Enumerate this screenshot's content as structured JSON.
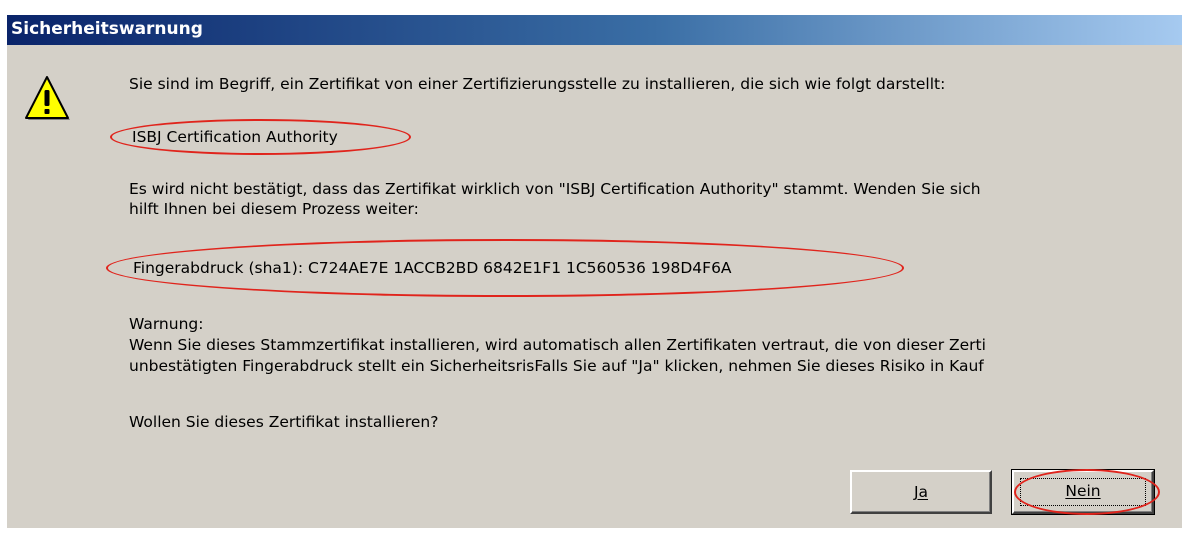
{
  "window": {
    "title": "Sicherheitswarnung"
  },
  "message": {
    "intro": "Sie sind im Begriff, ein Zertifikat von einer Zertifizierungsstelle zu installieren, die sich wie folgt darstellt:",
    "issuer": "ISBJ Certification Authority",
    "not_verified_line1": "Es wird nicht bestätigt, dass das Zertifikat wirklich von \"ISBJ Certification Authority\" stammt. Wenden Sie sich",
    "not_verified_line2": "hilft Ihnen bei diesem Prozess weiter:",
    "fingerprint": "Fingerabdruck (sha1): C724AE7E 1ACCB2BD 6842E1F1 1C560536 198D4F6A",
    "warning_heading": "Warnung:",
    "warning_line1": "Wenn Sie dieses Stammzertifikat installieren, wird automatisch allen Zertifikaten vertraut, die von dieser Zerti",
    "warning_line2": "unbestätigten Fingerabdruck stellt ein SicherheitsrisFalls Sie auf \"Ja\" klicken, nehmen Sie dieses Risiko in Kauf",
    "question": "Wollen Sie dieses Zertifikat installieren?"
  },
  "buttons": {
    "yes_label": "Ja",
    "no_label": "Nein"
  },
  "icons": {
    "warning": "warning-triangle-icon"
  },
  "colors": {
    "titlebar_start": "#0a246a",
    "titlebar_end": "#a6caf0",
    "dialog_background": "#d4d0c8",
    "annotation_red": "#e0241c"
  }
}
